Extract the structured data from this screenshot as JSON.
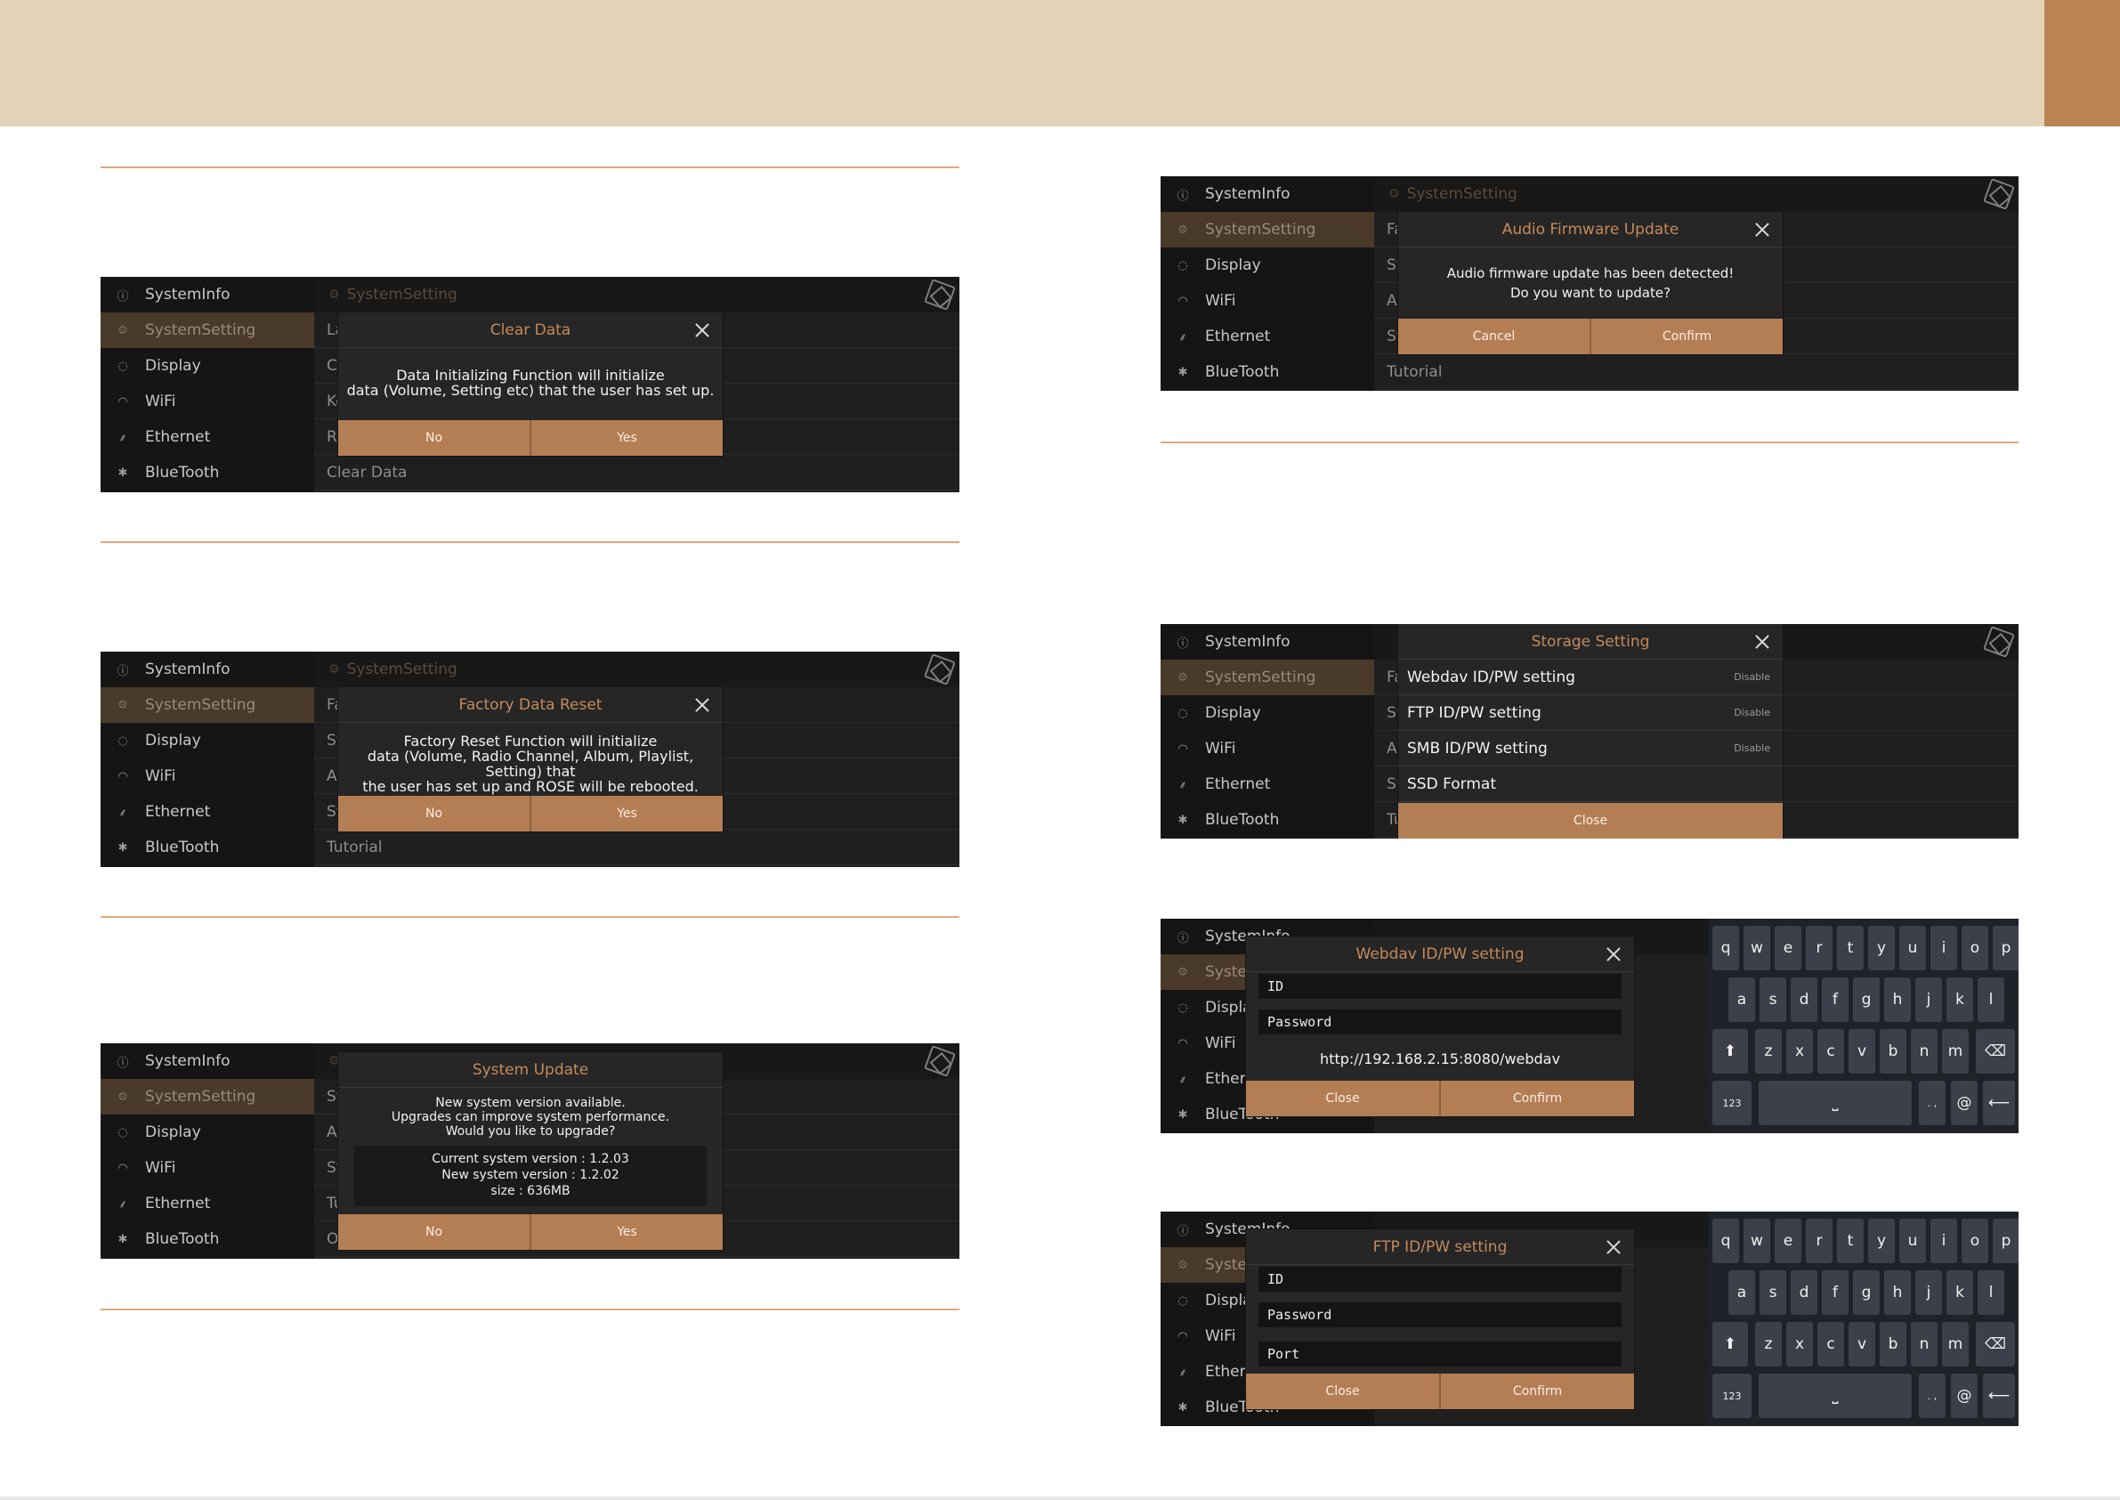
{
  "sidebar_items": [
    "SystemInfo",
    "SystemSetting",
    "Display",
    "WiFi",
    "Ethernet",
    "BlueTooth"
  ],
  "sidebar_icons": [
    "info-icon",
    "gear-icon",
    "display-icon",
    "wifi-icon",
    "ethernet-icon",
    "bluetooth-icon"
  ],
  "content_header": "SystemSetting",
  "colors": {
    "accent": "#b47e55",
    "band": "#e5d3b8",
    "tab": "#b98452",
    "rule": "#e3a77f"
  },
  "shot1": {
    "rows": [
      "La",
      "C",
      "Ke",
      "Re",
      "Clear Data"
    ],
    "dialog": {
      "title": "Clear Data",
      "body_line1": "Data Initializing Function will initialize",
      "body_line2": "data (Volume, Setting etc) that the user has set up.",
      "no": "No",
      "yes": "Yes"
    }
  },
  "shot2": {
    "rows": [
      "Fa",
      "Sy",
      "Au",
      "St",
      "Tutorial"
    ],
    "dialog": {
      "title": "Factory Data Reset",
      "body_line1": "Factory Reset Function will initialize",
      "body_line2": "data (Volume, Radio Channel, Album, Playlist, Setting) that",
      "body_line3": "the user has set up and ROSE will be rebooted.",
      "no": "No",
      "yes": "Yes"
    }
  },
  "shot3": {
    "rows": [
      "Sy",
      "Au",
      "St",
      "Tu",
      "O"
    ],
    "dialog": {
      "title": "System Update",
      "body_line1": "New system version available.",
      "body_line2": "Upgrades can improve system performance.",
      "body_line3": "Would you like to upgrade?",
      "info_line1": "Current system version : 1.2.03",
      "info_line2": "New system version : 1.2.02",
      "info_line3": "size : 636MB",
      "no": "No",
      "yes": "Yes"
    }
  },
  "shot4": {
    "rows": [
      "Fa",
      "Sy",
      "Au",
      "St",
      "Tutorial"
    ],
    "dialog": {
      "title": "Audio Firmware Update",
      "body_line1": "Audio firmware update has been detected!",
      "body_line2": "Do you want to update?",
      "cancel": "Cancel",
      "confirm": "Confirm"
    }
  },
  "shot5": {
    "rows": [
      "Fa",
      "Sy",
      "Au",
      "St",
      "Tu"
    ],
    "dialog": {
      "title": "Storage Setting",
      "items": [
        {
          "label": "Webdav ID/PW setting",
          "status": "Disable"
        },
        {
          "label": "FTP ID/PW setting",
          "status": "Disable"
        },
        {
          "label": "SMB ID/PW setting",
          "status": "Disable"
        },
        {
          "label": "SSD Format",
          "status": ""
        }
      ],
      "close": "Close"
    }
  },
  "shot6": {
    "dialog": {
      "title": "Webdav ID/PW setting",
      "id_placeholder": "ID",
      "password_placeholder": "Password",
      "url": "http://192.168.2.15:8080/webdav",
      "close": "Close",
      "confirm": "Confirm"
    }
  },
  "shot7": {
    "dialog": {
      "title": "FTP ID/PW setting",
      "id_placeholder": "ID",
      "password_placeholder": "Password",
      "port_placeholder": "Port",
      "close": "Close",
      "confirm": "Confirm"
    }
  },
  "keyboard": {
    "row1": [
      "q",
      "w",
      "e",
      "r",
      "t",
      "y",
      "u",
      "i",
      "o",
      "p"
    ],
    "row2": [
      "a",
      "s",
      "d",
      "f",
      "g",
      "h",
      "j",
      "k",
      "l"
    ],
    "row3": [
      "z",
      "x",
      "c",
      "v",
      "b",
      "n",
      "m"
    ],
    "num": "123",
    "space": "⎵",
    "punct": ". ,",
    "at": "@"
  }
}
